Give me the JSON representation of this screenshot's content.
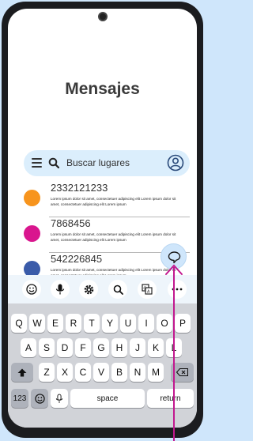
{
  "title": "Mensajes",
  "search": {
    "placeholder": "Buscar lugares"
  },
  "conversations": [
    {
      "number": "2332121233",
      "snippet": "Lorem ipsum dolor sit amet, consectetuer adipiscing elit Lorem ipsum dolor sit amet, consectetuer adipiscing elit Lorem ipsum",
      "color": "#f7941d"
    },
    {
      "number": "7868456",
      "snippet": "Lorem ipsum dolor sit amet, consectetuer adipiscing elit Lorem ipsum dolor sit amet, consectetuer adipiscing elit Lorem ipsum",
      "color": "#d9168e"
    },
    {
      "number": "542226845",
      "snippet": "Lorem ipsum dolor sit amet, consectetuer adipiscing elit Lorem ipsum dolor sit amet, consectetuer adipiscing elit Lorem ipsum",
      "color": "#3a5ba9"
    }
  ],
  "keyboard": {
    "row1": [
      "Q",
      "W",
      "E",
      "R",
      "T",
      "Y",
      "U",
      "I",
      "O",
      "P"
    ],
    "row2": [
      "A",
      "S",
      "D",
      "F",
      "G",
      "H",
      "J",
      "K",
      "L"
    ],
    "row3": [
      "Z",
      "X",
      "C",
      "V",
      "B",
      "N",
      "M"
    ],
    "num_label": "123",
    "space_label": "space",
    "return_label": "return"
  },
  "toolbar_icons": [
    "emoji-icon",
    "microphone-icon",
    "settings-icon",
    "search-icon",
    "translate-icon",
    "more-icon"
  ],
  "colors": {
    "accent": "#cfe6fb",
    "pointer": "#c2188f"
  }
}
